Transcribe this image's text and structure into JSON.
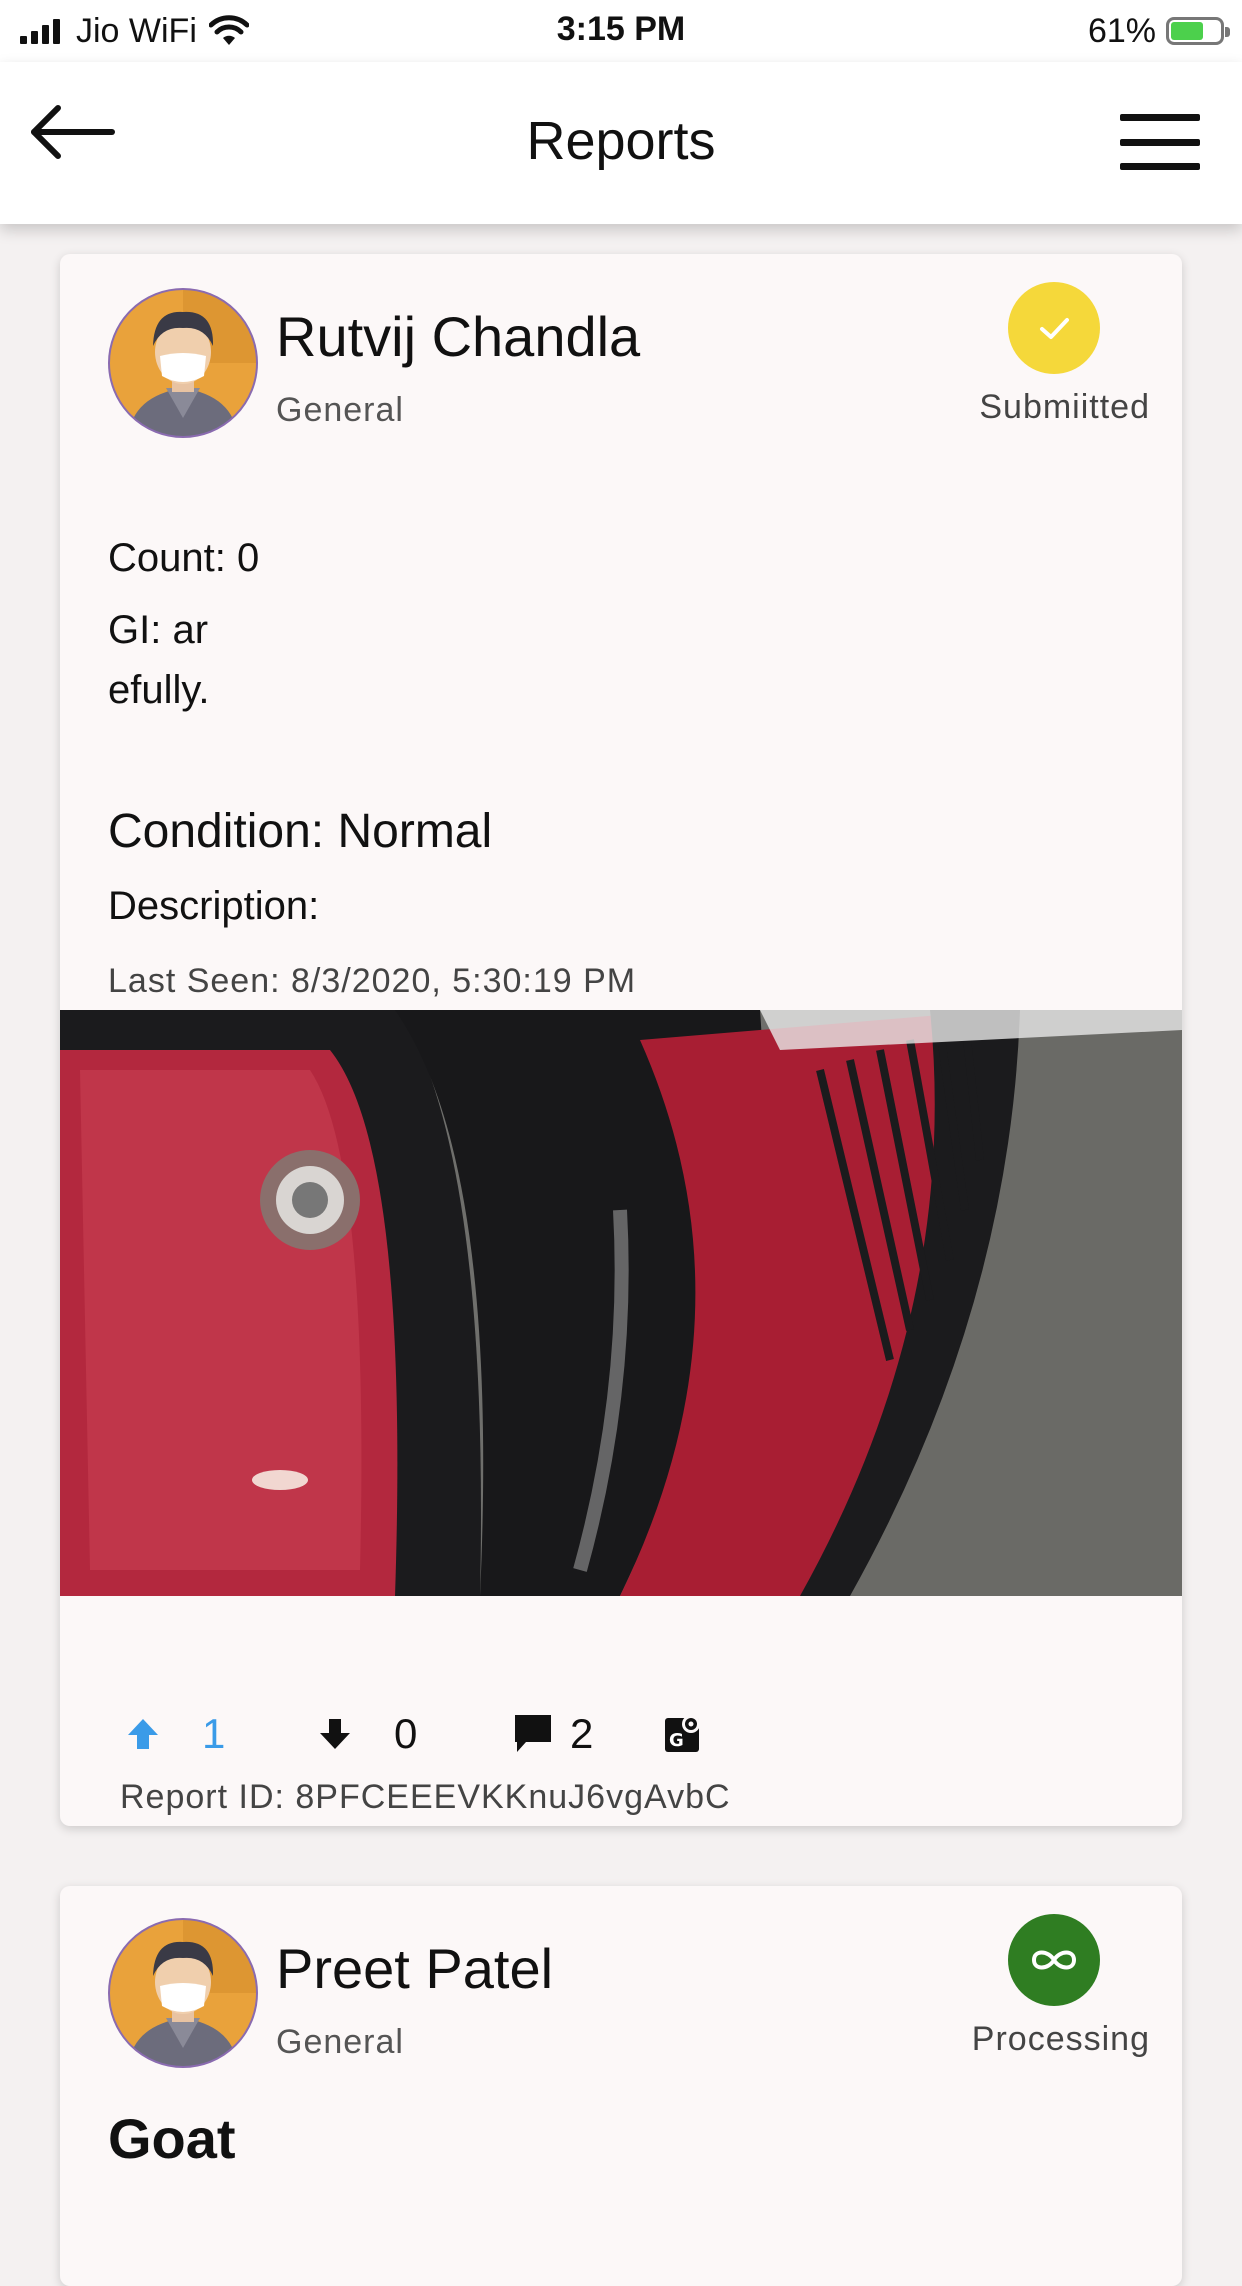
{
  "status_bar": {
    "carrier": "Jio WiFi",
    "time": "3:15 PM",
    "battery": "61%"
  },
  "appbar": {
    "title": "Reports"
  },
  "reports": [
    {
      "user_name": "Rutvij Chandla",
      "category": "General",
      "status": "Submiitted",
      "status_color": "#f5d83a",
      "count_line": "Count: 0",
      "gi_line1": "GI: ar",
      "gi_line2": "efully.",
      "condition": "Condition: Normal",
      "description": "Description:",
      "last_seen": "Last Seen: 8/3/2020, 5:30:19 PM",
      "upvotes": "1",
      "downvotes": "0",
      "comments": "2",
      "report_id": "Report ID: 8PFCEEEVKKnuJ6vgAvbC"
    },
    {
      "user_name": "Preet Patel",
      "category": "General",
      "status": "Processing",
      "status_color": "#2f7d22",
      "heading": "Goat"
    }
  ],
  "colors": {
    "accent_blue": "#3a9be8",
    "card_bg": "#fcf8f8"
  }
}
